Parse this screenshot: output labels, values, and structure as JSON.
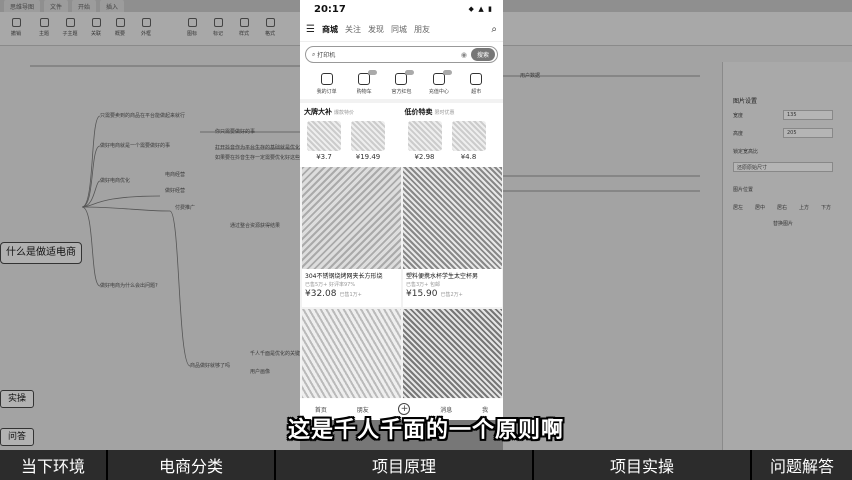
{
  "desktop": {
    "tabs": [
      "思维导图",
      "文件",
      "开始",
      "插入"
    ],
    "toolbar": [
      "撤销",
      "主题",
      "子主题",
      "关联",
      "概要",
      "外框",
      "图标",
      "标记",
      "样式",
      "格式"
    ],
    "mind_nodes": [
      "只需要卖到的商品在平台能做起来就行",
      "做好电商就是一个需要做好的事",
      "你只需要做好的事",
      "打开抖音作为平台生存的基础就是优化好的",
      "如果要在抖音生存一定需要优化好这些",
      "做好电商优化",
      "电商经营",
      "做好经营",
      "付费推广",
      "通过整合资源获得结果",
      "做好电商为什么会出问题?",
      "商品做好就够了吗",
      "千人千面是优化的关键",
      "用户画像",
      "用户数据"
    ],
    "root_label": "什么是做适电商",
    "side_nodes": [
      "实操",
      "问答"
    ],
    "panel": {
      "title": "图片设置",
      "width_label": "宽度",
      "width_value": "135",
      "height_label": "高度",
      "height_value": "205",
      "lock_label": "锁定宽高比",
      "restore_label": "还原原始尺寸",
      "position_label": "图片位置",
      "positions": [
        "居左",
        "居中",
        "居右",
        "上方",
        "下方"
      ],
      "replace_label": "替换图片"
    }
  },
  "phone": {
    "time": "20:17",
    "status_icons": "◆ ▲ ▮",
    "nav_tabs": [
      "商城",
      "关注",
      "发现",
      "同城",
      "朋友"
    ],
    "active_tab": "商城",
    "search_placeholder": "打印机",
    "search_button": "搜索",
    "shortcuts": [
      "我的订单",
      "购物车",
      "官方红包",
      "充值中心",
      "超市"
    ],
    "promo": [
      {
        "title": "大牌大补",
        "sub": "爆款特价",
        "prices": [
          "¥3.7",
          "¥19.49"
        ]
      },
      {
        "title": "低价特卖",
        "sub": "限时优惠",
        "prices": [
          "¥2.98",
          "¥4.8"
        ]
      }
    ],
    "products": [
      {
        "name": "304不锈钢烧烤网夹长方形烧",
        "meta": "已售5万+ 好评率97%",
        "price": "¥32.08",
        "sold": "已售1万+"
      },
      {
        "name": "塑料便携水杯学生太空杯男",
        "meta": "已售3万+ 包邮",
        "price": "¥15.90",
        "sold": "已售2万+"
      }
    ],
    "bottom_nav": [
      "首页",
      "朋友",
      "+",
      "消息",
      "我"
    ]
  },
  "subtitle": "这是千人千面的一个原则啊",
  "chapters": [
    "当下环境",
    "电商分类",
    "项目原理",
    "项目实操",
    "问题解答"
  ]
}
